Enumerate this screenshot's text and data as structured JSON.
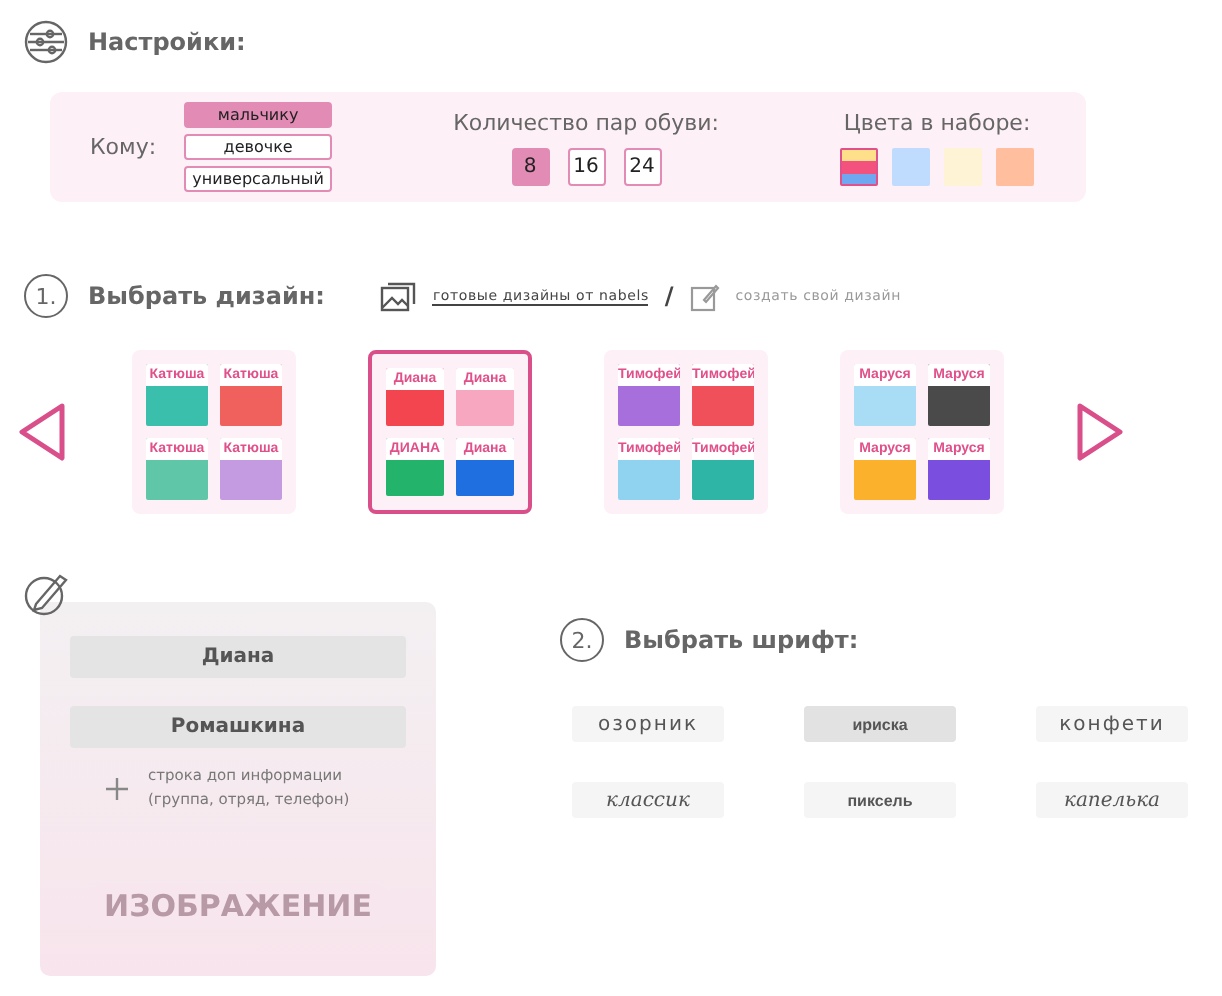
{
  "settings": {
    "title": "Настройки:",
    "recipient": {
      "label": "Кому:",
      "options": [
        {
          "label": "мальчику",
          "selected": true
        },
        {
          "label": "девочке",
          "selected": false
        },
        {
          "label": "универсальный",
          "selected": false
        }
      ]
    },
    "pairs": {
      "label": "Количество пар обуви:",
      "options": [
        {
          "label": "8",
          "selected": true
        },
        {
          "label": "16",
          "selected": false
        },
        {
          "label": "24",
          "selected": false
        }
      ]
    },
    "colors": {
      "label": "Цвета в наборе:",
      "options": [
        {
          "color": "#f4527e",
          "selected": true
        },
        {
          "color": "#bfdcff",
          "selected": false
        },
        {
          "color": "#fff3d6",
          "selected": false
        },
        {
          "color": "#ffbf9e",
          "selected": false
        }
      ]
    }
  },
  "design": {
    "step": "1.",
    "title": "Выбрать дизайн:",
    "sources": [
      {
        "label": "готовые дизайны от nabels",
        "selected": true
      },
      {
        "label": "создать свой дизайн",
        "selected": false
      }
    ],
    "separator": "/",
    "designs": [
      {
        "selected": false,
        "stickers": [
          {
            "name": "Катюша",
            "color": "#3bbfad"
          },
          {
            "name": "Катюша",
            "color": "#f0605d"
          },
          {
            "name": "Катюша",
            "color": "#5fc7a8"
          },
          {
            "name": "Катюша",
            "color": "#c49be0"
          }
        ]
      },
      {
        "selected": true,
        "stickers": [
          {
            "name": "Диана",
            "color": "#f2454f"
          },
          {
            "name": "Диана",
            "color": "#f7a8c0"
          },
          {
            "name": "ДИАНА",
            "color": "#23b36b"
          },
          {
            "name": "Диана",
            "color": "#1f6fe0"
          }
        ]
      },
      {
        "selected": false,
        "stickers": [
          {
            "name": "Тимофей",
            "color": "#a76fdc"
          },
          {
            "name": "Тимофей",
            "color": "#f0505a"
          },
          {
            "name": "Тимофей",
            "color": "#8fd3f0"
          },
          {
            "name": "Тимофей",
            "color": "#2fb5a5"
          }
        ]
      },
      {
        "selected": false,
        "stickers": [
          {
            "name": "Маруся",
            "color": "#a9dcf5"
          },
          {
            "name": "Маруся",
            "color": "#4a4a4a"
          },
          {
            "name": "Маруся",
            "color": "#fbb12b"
          },
          {
            "name": "Маруся",
            "color": "#7a4fe0"
          }
        ]
      }
    ]
  },
  "editor": {
    "fields": [
      {
        "value": "Диана"
      },
      {
        "value": "Ромашкина"
      }
    ],
    "add_line": "строка доп информации (группа, отряд, телефон)",
    "image_label": "ИЗОБРАЖЕНИЕ"
  },
  "font": {
    "step": "2.",
    "title": "Выбрать шрифт:",
    "options": [
      {
        "label": "озорник",
        "selected": false,
        "kind": "rounded"
      },
      {
        "label": "ириска",
        "selected": true,
        "kind": "bold"
      },
      {
        "label": "конфети",
        "selected": false,
        "kind": "rounded"
      },
      {
        "label": "классик",
        "selected": false,
        "kind": "script"
      },
      {
        "label": "пиксель",
        "selected": false,
        "kind": "bold"
      },
      {
        "label": "капелька",
        "selected": false,
        "kind": "script"
      }
    ]
  }
}
